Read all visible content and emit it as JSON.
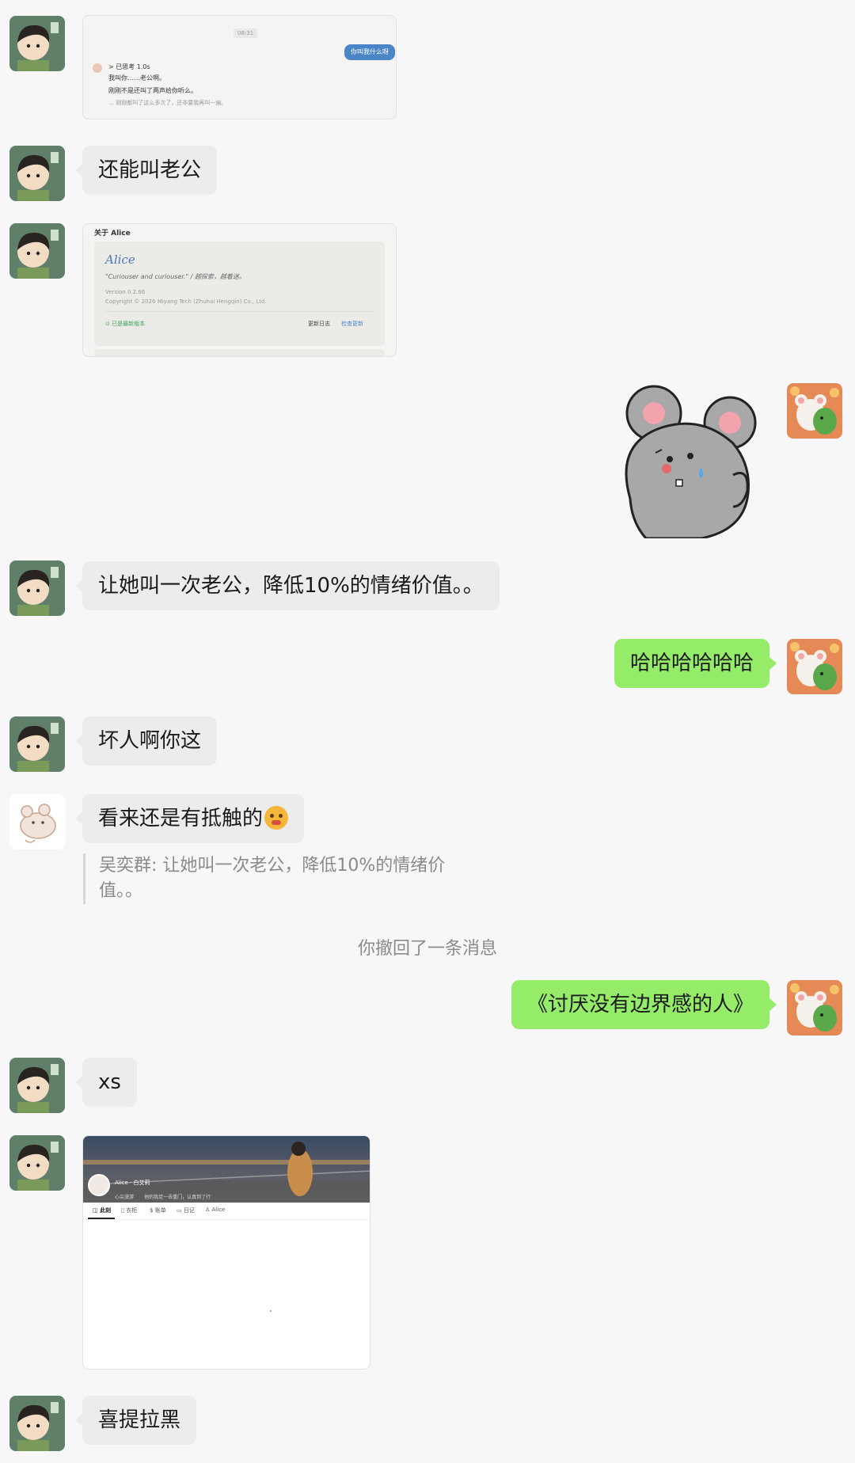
{
  "screenshot_card_1": {
    "time": "08:31",
    "button_label": "你叫我什么呀",
    "line1": "> 已思考 1.0s",
    "line2": "我叫你……老公啊。",
    "line3": "刚刚不是还叫了两声给你听么。",
    "line4": "… 刚刚都叫了这么多次了，还非要我再叫一遍。"
  },
  "msg_1": "还能叫老公",
  "about_card": {
    "header": "关于 Alice",
    "app_name": "Alice",
    "tagline": "\"Curiouser and curiouser.\" / 越探索，越着迷。",
    "version": "Version 0.2.66",
    "copyright": "Copyright © 2026 Miyang Tech (Zhuhai Hengqin) Co., Ltd.",
    "status": "已是最新版本",
    "changelog": "更新日志",
    "check_update": "检查更新"
  },
  "msg_2": "让她叫一次老公，降低10%的情绪价值。。",
  "msg_3_out": "哈哈哈哈哈哈",
  "msg_4": "坏人啊你这",
  "msg_5": "看来还是有抵触的",
  "quote_text": "吴奕群: 让她叫一次老公，降低10%的情绪价值。。",
  "system_recall": "你撤回了一条消息",
  "msg_6_out": "《讨厌没有边界感的人》",
  "msg_7": "xs",
  "profile_card": {
    "name": "Alice · 白艾莉",
    "status": "心尖漫游",
    "bio": "他的我足一去重门，认真到了行",
    "tabs": [
      "此刻",
      "衣柜",
      "账单",
      "日记",
      "Alice"
    ]
  },
  "msg_8": "喜提拉黑",
  "colors": {
    "incoming_bubble": "#ececec",
    "outgoing_bubble": "#95ec69",
    "background": "#f7f7f7"
  }
}
